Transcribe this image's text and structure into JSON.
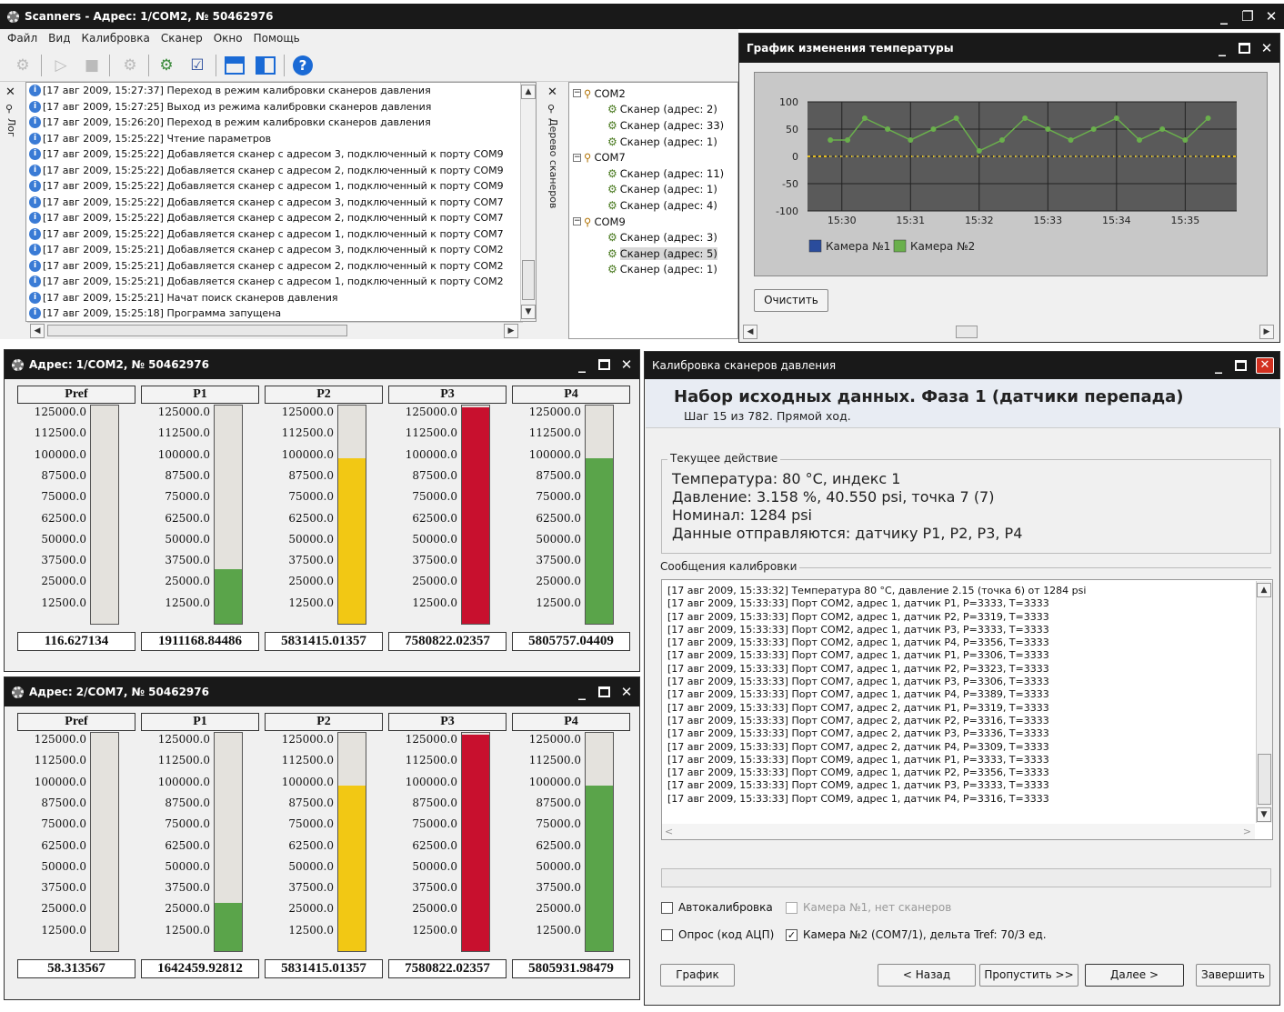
{
  "app": {
    "title": "Scanners - Адрес: 1/COM2, № 50462976"
  },
  "menu": [
    "Файл",
    "Вид",
    "Калибровка",
    "Сканер",
    "Окно",
    "Помощь"
  ],
  "log": {
    "tab_label": "Лог",
    "rows": [
      "[17 авг 2009, 15:27:37]  Переход в режим калибровки сканеров давления",
      "[17 авг 2009, 15:27:25]  Выход из режима калибровки сканеров давления",
      "[17 авг 2009, 15:26:20]  Переход в режим калибровки сканеров давления",
      "[17 авг 2009, 15:25:22]  Чтение параметров",
      "[17 авг 2009, 15:25:22]  Добавляется сканер с адресом 3, подключенный к порту COM9",
      "[17 авг 2009, 15:25:22]  Добавляется сканер с адресом 2, подключенный к порту COM9",
      "[17 авг 2009, 15:25:22]  Добавляется сканер с адресом 1, подключенный к порту COM9",
      "[17 авг 2009, 15:25:22]  Добавляется сканер с адресом 3, подключенный к порту COM7",
      "[17 авг 2009, 15:25:22]  Добавляется сканер с адресом 2, подключенный к порту COM7",
      "[17 авг 2009, 15:25:22]  Добавляется сканер с адресом 1, подключенный к порту COM7",
      "[17 авг 2009, 15:25:21]  Добавляется сканер с адресом 3, подключенный к порту COM2",
      "[17 авг 2009, 15:25:21]  Добавляется сканер с адресом 2, подключенный к порту COM2",
      "[17 авг 2009, 15:25:21]  Добавляется сканер с адресом 1, подключенный к порту COM2",
      "[17 авг 2009, 15:25:21]  Начат поиск сканеров давления",
      "[17 авг 2009, 15:25:18]  Программа запущена"
    ]
  },
  "tree": {
    "tab_label": "Дерево сканеров",
    "ports": [
      {
        "name": "COM2",
        "scanners": [
          "Сканер (адрес: 2)",
          "Сканер (адрес: 33)",
          "Сканер (адрес: 1)"
        ]
      },
      {
        "name": "COM7",
        "scanners": [
          "Сканер (адрес: 11)",
          "Сканер (адрес: 1)",
          "Сканер (адрес: 4)"
        ]
      },
      {
        "name": "COM9",
        "scanners": [
          "Сканер (адрес: 3)",
          "Сканер (адрес: 5)",
          "Сканер (адрес: 1)"
        ]
      }
    ]
  },
  "chart_window": {
    "title": "График изменения температуры",
    "clear_label": "Очистить"
  },
  "chart_data": {
    "type": "line",
    "x": [
      "15:29:50",
      "15:30:05",
      "15:30:20",
      "15:30:40",
      "15:31:00",
      "15:31:20",
      "15:31:40",
      "15:32:00",
      "15:32:20",
      "15:32:40",
      "15:33:00",
      "15:33:20",
      "15:33:40",
      "15:34:00",
      "15:34:20",
      "15:34:40",
      "15:35:00",
      "15:35:20"
    ],
    "xticks": [
      "15:30",
      "15:31",
      "15:32",
      "15:33",
      "15:34",
      "15:35"
    ],
    "yticks": [
      "100",
      "50",
      "0",
      "-50",
      "-100"
    ],
    "ylim": [
      -100,
      100
    ],
    "series": [
      {
        "name": "Камера №1",
        "color": "#2a4c9c",
        "values": [
          0,
          0,
          0,
          0,
          0,
          0,
          0,
          0,
          0,
          0,
          0,
          0,
          0,
          0,
          0,
          0,
          0,
          0
        ]
      },
      {
        "name": "Камера №2",
        "color": "#6ab04c",
        "values": [
          30,
          30,
          70,
          50,
          30,
          50,
          70,
          10,
          30,
          70,
          50,
          30,
          50,
          70,
          30,
          50,
          30,
          70
        ]
      }
    ],
    "grid": true,
    "legend": "bottom"
  },
  "scanner_windows": [
    {
      "title": "Адрес: 1/COM2, № 50462976",
      "gauges": [
        {
          "label": "Pref",
          "fill": 0,
          "value": "116.627134"
        },
        {
          "label": "P1",
          "fill": 0.25,
          "value": "1911168.84486"
        },
        {
          "label": "P2",
          "fill": 0.76,
          "value": "5831415.01357"
        },
        {
          "label": "P3",
          "fill": 0.99,
          "value": "7580822.02357"
        },
        {
          "label": "P4",
          "fill": 0.76,
          "value": "5805757.04409"
        }
      ]
    },
    {
      "title": "Адрес: 2/COM7, № 50462976",
      "gauges": [
        {
          "label": "Pref",
          "fill": 0,
          "value": "58.313567"
        },
        {
          "label": "P1",
          "fill": 0.22,
          "value": "1642459.92812"
        },
        {
          "label": "P2",
          "fill": 0.76,
          "value": "5831415.01357"
        },
        {
          "label": "P3",
          "fill": 0.99,
          "value": "7580822.02357"
        },
        {
          "label": "P4",
          "fill": 0.76,
          "value": "5805931.98479"
        }
      ]
    }
  ],
  "scale_ticks": [
    "125000.0",
    "112500.0",
    "100000.0",
    "87500.0",
    "75000.0",
    "62500.0",
    "50000.0",
    "37500.0",
    "25000.0",
    "12500.0"
  ],
  "calibration": {
    "title": "Калибровка сканеров давления",
    "heading": "Набор исходных данных. Фаза 1 (датчики перепада)",
    "subheading": "Шаг 15 из 782. Прямой ход.",
    "current_action_label": "Текущее действие",
    "current_action": [
      "Температура: 80 °C, индекс 1",
      "Давление: 3.158 %, 40.550 psi, точка 7 (7)",
      "Номинал: 1284 psi",
      "Данные отправляются: датчику P1, P2, P3, P4"
    ],
    "messages_label": "Сообщения калибровки",
    "messages": [
      "[17 авг 2009, 15:33:32] Температура 80 °C, давление 2.15 (точка 6) от 1284 psi",
      "[17 авг 2009, 15:33:33] Порт COM2, адрес 1, датчик P1, P=3333, T=3333",
      "[17 авг 2009, 15:33:33] Порт COM2, адрес 1, датчик P2, P=3319, T=3333",
      "[17 авг 2009, 15:33:33] Порт COM2, адрес 1, датчик P3, P=3333, T=3333",
      "[17 авг 2009, 15:33:33] Порт COM2, адрес 1, датчик P4, P=3356, T=3333",
      "[17 авг 2009, 15:33:33] Порт COM7, адрес 1, датчик P1, P=3306, T=3333",
      "[17 авг 2009, 15:33:33] Порт COM7, адрес 1, датчик P2, P=3323, T=3333",
      "[17 авг 2009, 15:33:33] Порт COM7, адрес 1, датчик P3, P=3306, T=3333",
      "[17 авг 2009, 15:33:33] Порт COM7, адрес 1, датчик P4, P=3389, T=3333",
      "[17 авг 2009, 15:33:33] Порт COM7, адрес 2, датчик P1, P=3319, T=3333",
      "[17 авг 2009, 15:33:33] Порт COM7, адрес 2, датчик P2, P=3316, T=3333",
      "[17 авг 2009, 15:33:33] Порт COM7, адрес 2, датчик P3, P=3336, T=3333",
      "[17 авг 2009, 15:33:33] Порт COM7, адрес 2, датчик P4, P=3309, T=3333",
      "[17 авг 2009, 15:33:33] Порт COM9, адрес 1, датчик P1, P=3333, T=3333",
      "[17 авг 2009, 15:33:33] Порт COM9, адрес 1, датчик P2, P=3356, T=3333",
      "[17 авг 2009, 15:33:33] Порт COM9, адрес 1, датчик P3, P=3333, T=3333",
      "[17 авг 2009, 15:33:33] Порт COM9, адрес 1, датчик P4, P=3316, T=3333"
    ],
    "autocal_label": "Автокалибровка",
    "poll_label": "Опрос (код АЦП)",
    "cam1_label": "Камера №1, нет сканеров",
    "cam2_label": "Камера №2 (COM7/1), дельта Tref: 70/3 ед.",
    "buttons": {
      "graph": "График",
      "back": "< Назад",
      "skip": "Пропустить >>",
      "next": "Далее >",
      "finish": "Завершить"
    }
  }
}
